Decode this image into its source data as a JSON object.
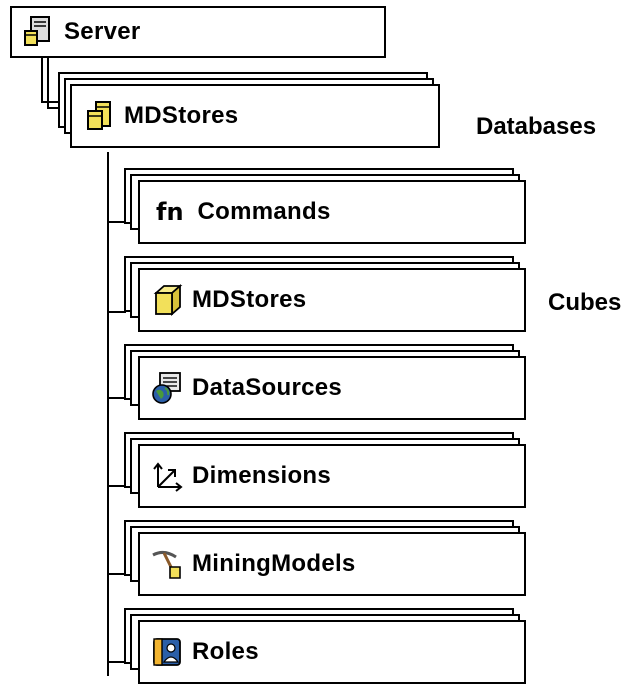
{
  "nodes": {
    "server": "Server",
    "database": "MDStores",
    "commands": {
      "prefix": "fn",
      "label": "Commands"
    },
    "cube": "MDStores",
    "datasources": "DataSources",
    "dimensions": "Dimensions",
    "miningmodels": "MiningModels",
    "roles": "Roles"
  },
  "annotations": {
    "databases": "Databases",
    "cubes": "Cubes"
  },
  "icons": {
    "server": "server-icon",
    "database": "database-icon",
    "cube": "cube-icon",
    "datasources": "datasource-globe-icon",
    "dimensions": "dimension-arrows-icon",
    "miningmodels": "mining-pick-icon",
    "roles": "roles-icon"
  },
  "colors": {
    "line": "#000000",
    "cube_yellow": "#f2e05a",
    "globe_blue": "#2b5fa8"
  }
}
